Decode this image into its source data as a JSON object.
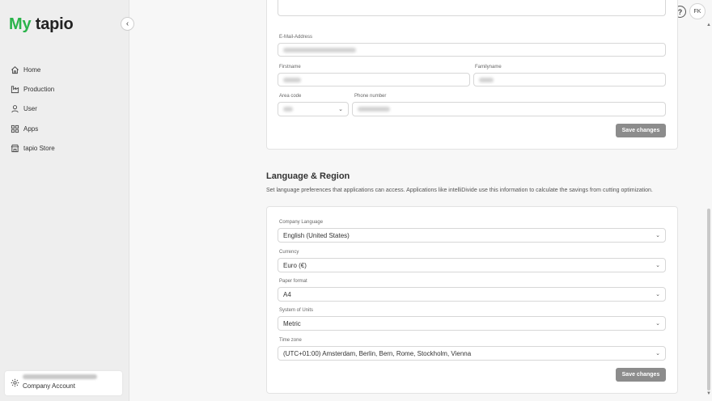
{
  "sidebar": {
    "logo_my": "My",
    "logo_tapio": "tapio",
    "items": [
      {
        "label": "Home",
        "icon": "home-icon"
      },
      {
        "label": "Production",
        "icon": "factory-icon"
      },
      {
        "label": "User",
        "icon": "user-icon"
      },
      {
        "label": "Apps",
        "icon": "apps-icon"
      },
      {
        "label": "tapio Store",
        "icon": "store-icon"
      }
    ],
    "account_label": "Company Account"
  },
  "topbar": {
    "help": "?",
    "avatar": "FK"
  },
  "profile": {
    "email_label": "E-Mail-Address",
    "firstname_label": "Firstname",
    "familyname_label": "Familyname",
    "area_code_label": "Area code",
    "phone_label": "Phone number",
    "save_label": "Save changes"
  },
  "region": {
    "title": "Language & Region",
    "description": "Set language preferences that applications can access. Applications like intelliDivide use this information to calculate the savings from cutting optimization.",
    "company_language_label": "Company Language",
    "company_language_value": "English (United States)",
    "currency_label": "Currency",
    "currency_value": "Euro (€)",
    "paper_label": "Paper format",
    "paper_value": "A4",
    "units_label": "System of Units",
    "units_value": "Metric",
    "timezone_label": "Time zone",
    "timezone_value": "(UTC+01:00) Amsterdam, Berlin, Bern, Rome, Stockholm, Vienna",
    "save_label": "Save changes"
  },
  "colors": {
    "brand_green": "#2ab34a",
    "button_gray": "#8c8c8c"
  }
}
